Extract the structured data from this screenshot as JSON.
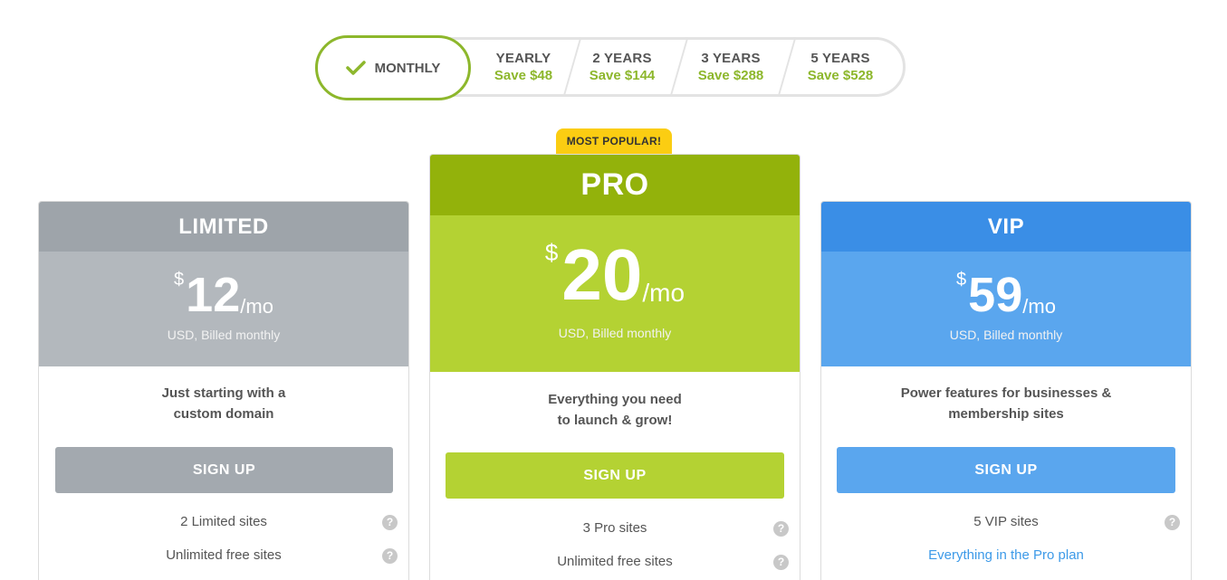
{
  "billing_toggle": {
    "active": {
      "label": "MONTHLY"
    },
    "options": [
      {
        "label": "YEARLY",
        "save": "Save $48"
      },
      {
        "label": "2 YEARS",
        "save": "Save $144"
      },
      {
        "label": "3 YEARS",
        "save": "Save $288"
      },
      {
        "label": "5 YEARS",
        "save": "Save $528"
      }
    ],
    "colors": {
      "accent": "#8db72c",
      "border": "#e3e3e3"
    }
  },
  "badge": {
    "label": "MOST POPULAR!",
    "color": "#fbcd12"
  },
  "plans": {
    "limited": {
      "name": "LIMITED",
      "currency": "$",
      "price": "12",
      "period": "/mo",
      "billed": "USD, Billed monthly",
      "description_line1": "Just starting with a",
      "description_line2": "custom domain",
      "button_label": "SIGN UP",
      "features": [
        "2 Limited sites",
        "Unlimited free sites"
      ],
      "colors": {
        "head": "#9ea4aa",
        "price": "#b3b8bd",
        "button": "#a3a9af"
      }
    },
    "pro": {
      "name": "PRO",
      "currency": "$",
      "price": "20",
      "period": "/mo",
      "billed": "USD, Billed monthly",
      "description_line1": "Everything you need",
      "description_line2": "to launch & grow!",
      "button_label": "SIGN UP",
      "features": [
        "3 Pro sites",
        "Unlimited free sites"
      ],
      "colors": {
        "head": "#93b20b",
        "price": "#b4d233",
        "button": "#b4d233"
      }
    },
    "vip": {
      "name": "VIP",
      "currency": "$",
      "price": "59",
      "period": "/mo",
      "billed": "USD, Billed monthly",
      "description_line1": "Power features for businesses &",
      "description_line2": "membership sites",
      "button_label": "SIGN UP",
      "features": [
        "5 VIP sites",
        "Everything in the Pro plan"
      ],
      "colors": {
        "head": "#3a8ee6",
        "price": "#5aa6ee",
        "button": "#5aa6ee"
      }
    }
  },
  "icons": {
    "check": "check-icon",
    "help": "help-icon",
    "help_glyph": "?"
  }
}
